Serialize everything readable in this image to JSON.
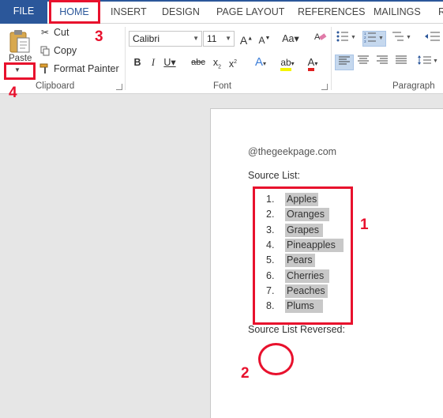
{
  "tabs": [
    "FILE",
    "HOME",
    "INSERT",
    "DESIGN",
    "PAGE LAYOUT",
    "REFERENCES",
    "MAILINGS",
    "R"
  ],
  "ribbon": {
    "clipboard": {
      "paste_label": "Paste",
      "cut_label": "Cut",
      "copy_label": "Copy",
      "format_painter_label": "Format Painter",
      "group_label": "Clipboard"
    },
    "font": {
      "font_name": "Calibri",
      "font_size": "11",
      "group_label": "Font"
    },
    "paragraph": {
      "group_label": "Paragraph"
    }
  },
  "document": {
    "site": "@thegeekpage.com",
    "source_heading": "Source List:",
    "list": [
      {
        "num": "1.",
        "text": "Apples"
      },
      {
        "num": "2.",
        "text": "Oranges"
      },
      {
        "num": "3.",
        "text": "Grapes"
      },
      {
        "num": "4.",
        "text": "Pineapples"
      },
      {
        "num": "5.",
        "text": "Pears"
      },
      {
        "num": "6.",
        "text": "Cherries"
      },
      {
        "num": "7.",
        "text": "Peaches"
      },
      {
        "num": "8.",
        "text": "Plums"
      }
    ],
    "reversed_heading": "Source List Reversed:"
  },
  "annotations": {
    "n1": "1",
    "n2": "2",
    "n3": "3",
    "n4": "4"
  },
  "colors": {
    "accent": "#2b579a",
    "annotation": "#e8112d",
    "highlight": "#c8c8c8"
  },
  "icons": [
    "paste-icon",
    "scissors-icon",
    "copy-icon",
    "paintbrush-icon",
    "eraser-icon",
    "bullets-icon",
    "numbering-icon",
    "multilevel-list-icon",
    "decrease-indent-icon",
    "align-left-icon",
    "align-center-icon",
    "align-right-icon",
    "justify-icon",
    "line-spacing-icon",
    "text-effects-icon",
    "highlighter-icon",
    "font-color-icon"
  ]
}
